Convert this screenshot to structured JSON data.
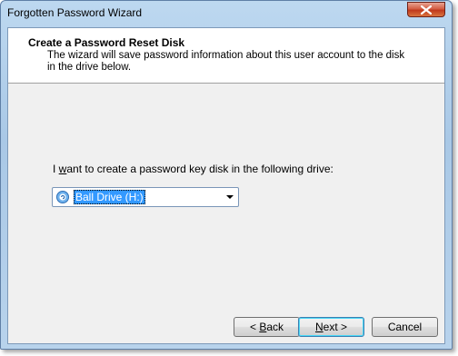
{
  "window": {
    "title": "Forgotten Password Wizard"
  },
  "header": {
    "title": "Create a Password Reset Disk",
    "description": "The wizard will save password information about this user account to the disk in the drive below."
  },
  "main": {
    "prompt_prefix": "I ",
    "prompt_access_key": "w",
    "prompt_suffix": "ant to create a password key disk in the following drive:",
    "drive_select": {
      "selected_value": "Ball Drive (H:)",
      "icon": "cd-drive-icon"
    }
  },
  "buttons": {
    "back_prefix": "< ",
    "back_access_key": "B",
    "back_suffix": "ack",
    "next_access_key": "N",
    "next_suffix": "ext >",
    "cancel_label": "Cancel"
  },
  "colors": {
    "selection": "#3399ff",
    "close_button": "#c0391d",
    "frame": "#a9c8e6"
  }
}
